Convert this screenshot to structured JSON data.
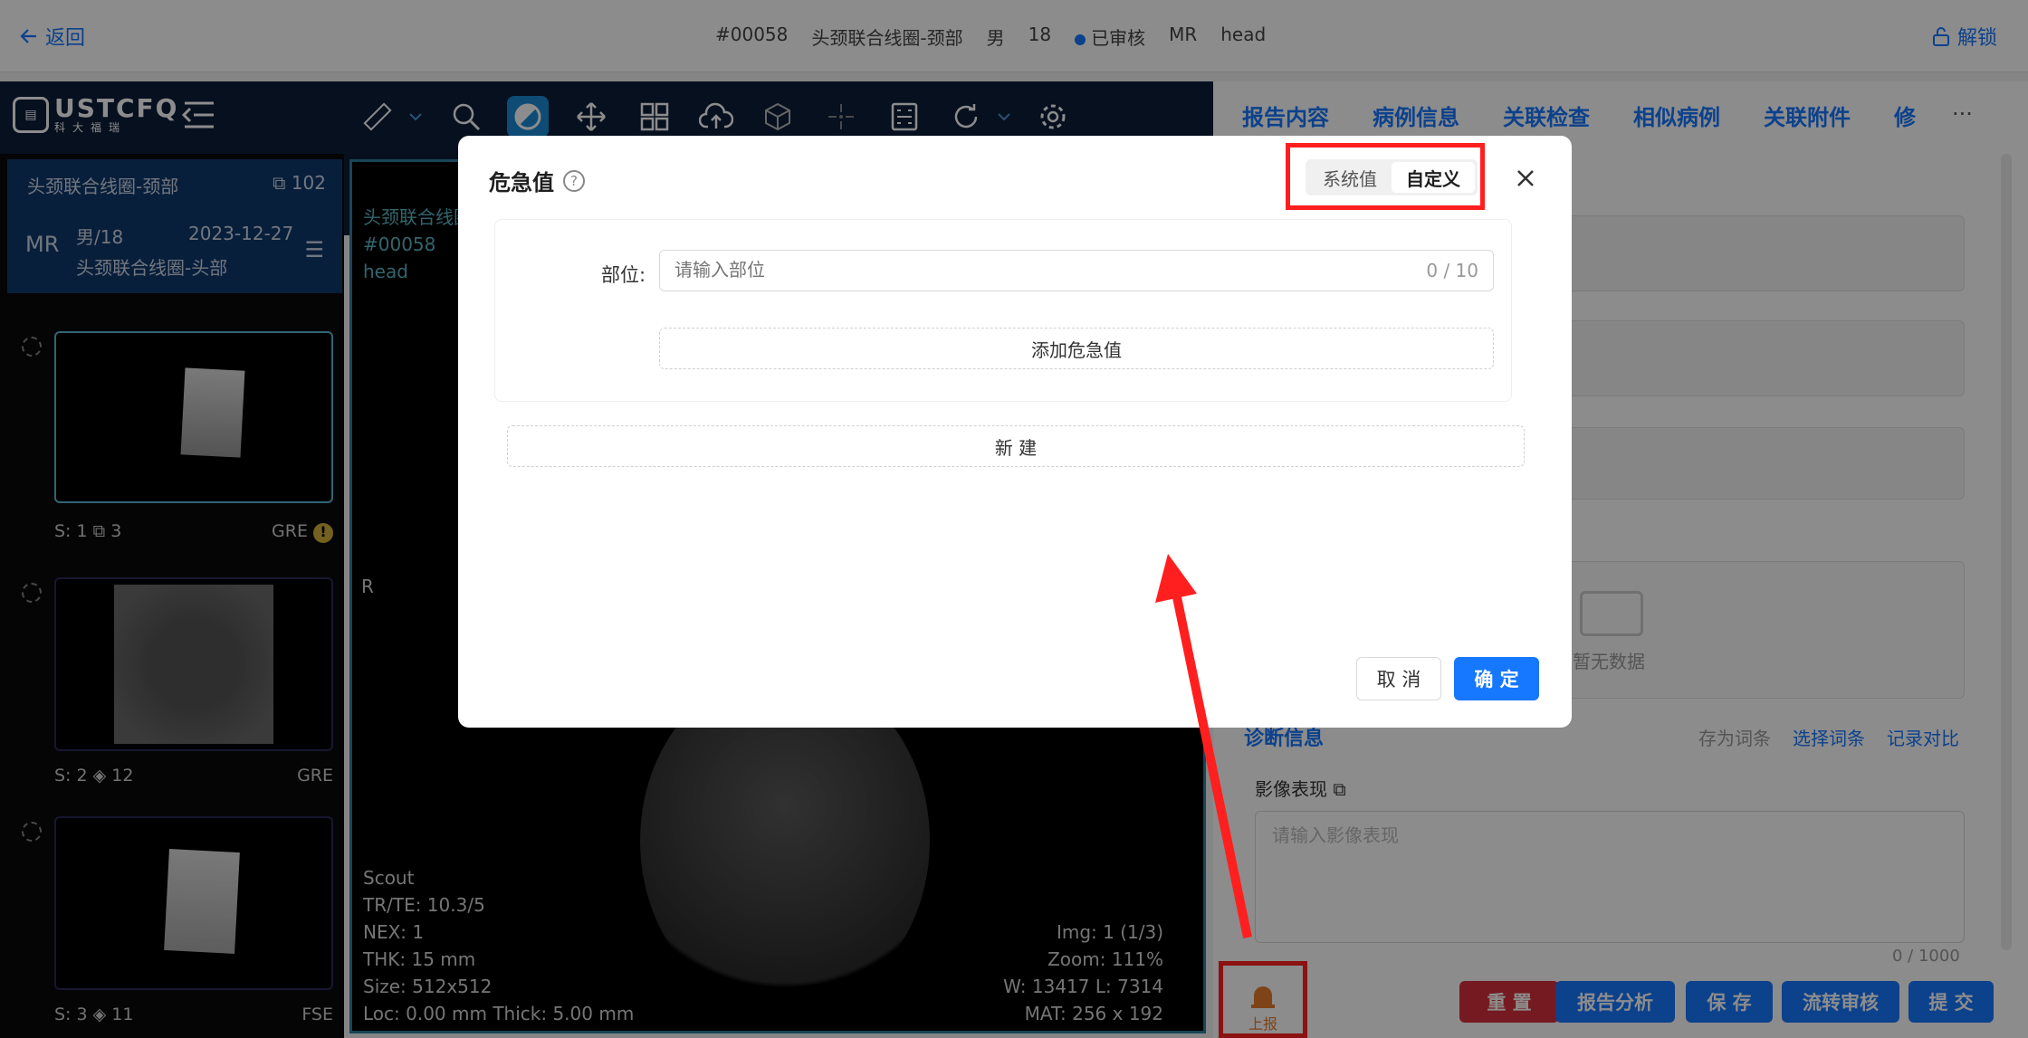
{
  "topbar": {
    "back_label": "返回",
    "patient_info": [
      "#00058",
      "头颈联合线圈-颈部",
      "男",
      "18",
      "已审核",
      "MR",
      "head"
    ],
    "unlock_label": "解锁"
  },
  "logo": {
    "text": "USTCFQ",
    "sub": "科大福瑞"
  },
  "series_header": {
    "name": "头颈联合线圈-颈部",
    "count": "102",
    "modality": "MR",
    "sex_age": "男/18",
    "date": "2023-12-27",
    "sub_name": "头颈联合线圈-头部"
  },
  "thumbnails": [
    {
      "series": "S: 1",
      "count": "3",
      "type": "GRE"
    },
    {
      "series": "S: 2",
      "count": "12",
      "type": "GRE"
    },
    {
      "series": "S: 3",
      "count": "11",
      "type": "FSE"
    }
  ],
  "viewport": {
    "top_lines": [
      "头颈联合线圈",
      "#00058",
      "head"
    ],
    "orient": "R",
    "bottom_left": [
      "Scout",
      "TR/TE: 10.3/5",
      "NEX: 1",
      "THK: 15 mm",
      "Size: 512x512",
      "Loc: 0.00 mm Thick: 5.00 mm"
    ],
    "bottom_right": [
      "Img: 1 (1/3)",
      "Zoom: 111%",
      "W:  13417  L:  7314",
      "MAT:  256 x 192"
    ]
  },
  "right": {
    "tabs": [
      "报告内容",
      "病例信息",
      "关联检查",
      "相似病例",
      "关联附件",
      "修"
    ],
    "more": "···",
    "empty": "暂无数据",
    "diag_title": "诊断信息",
    "links": [
      "存为词条",
      "选择词条",
      "记录对比"
    ],
    "image_label": "影像表现",
    "image_placeholder": "请输入影像表现",
    "image_count": "0 / 1000",
    "report_label": "上报"
  },
  "bottom_buttons": [
    {
      "label": "重 置",
      "color": "#d6303b"
    },
    {
      "label": "报告分析",
      "color": "#1677ff"
    },
    {
      "label": "保 存",
      "color": "#1677ff"
    },
    {
      "label": "流转审核",
      "color": "#1677ff"
    },
    {
      "label": "提 交",
      "color": "#1677ff"
    }
  ],
  "modal": {
    "title": "危急值",
    "help": "?",
    "seg": [
      "系统值",
      "自定义"
    ],
    "part_label": "部位:",
    "part_placeholder": "请输入部位",
    "part_count": "0 / 10",
    "add_label": "添加危急值",
    "new_label": "新 建",
    "cancel_label": "取 消",
    "ok_label": "确 定"
  },
  "colors": {
    "accent": "#1677ff",
    "highlight": "#ff1f1f",
    "toolbar": "#0c1e3a"
  }
}
